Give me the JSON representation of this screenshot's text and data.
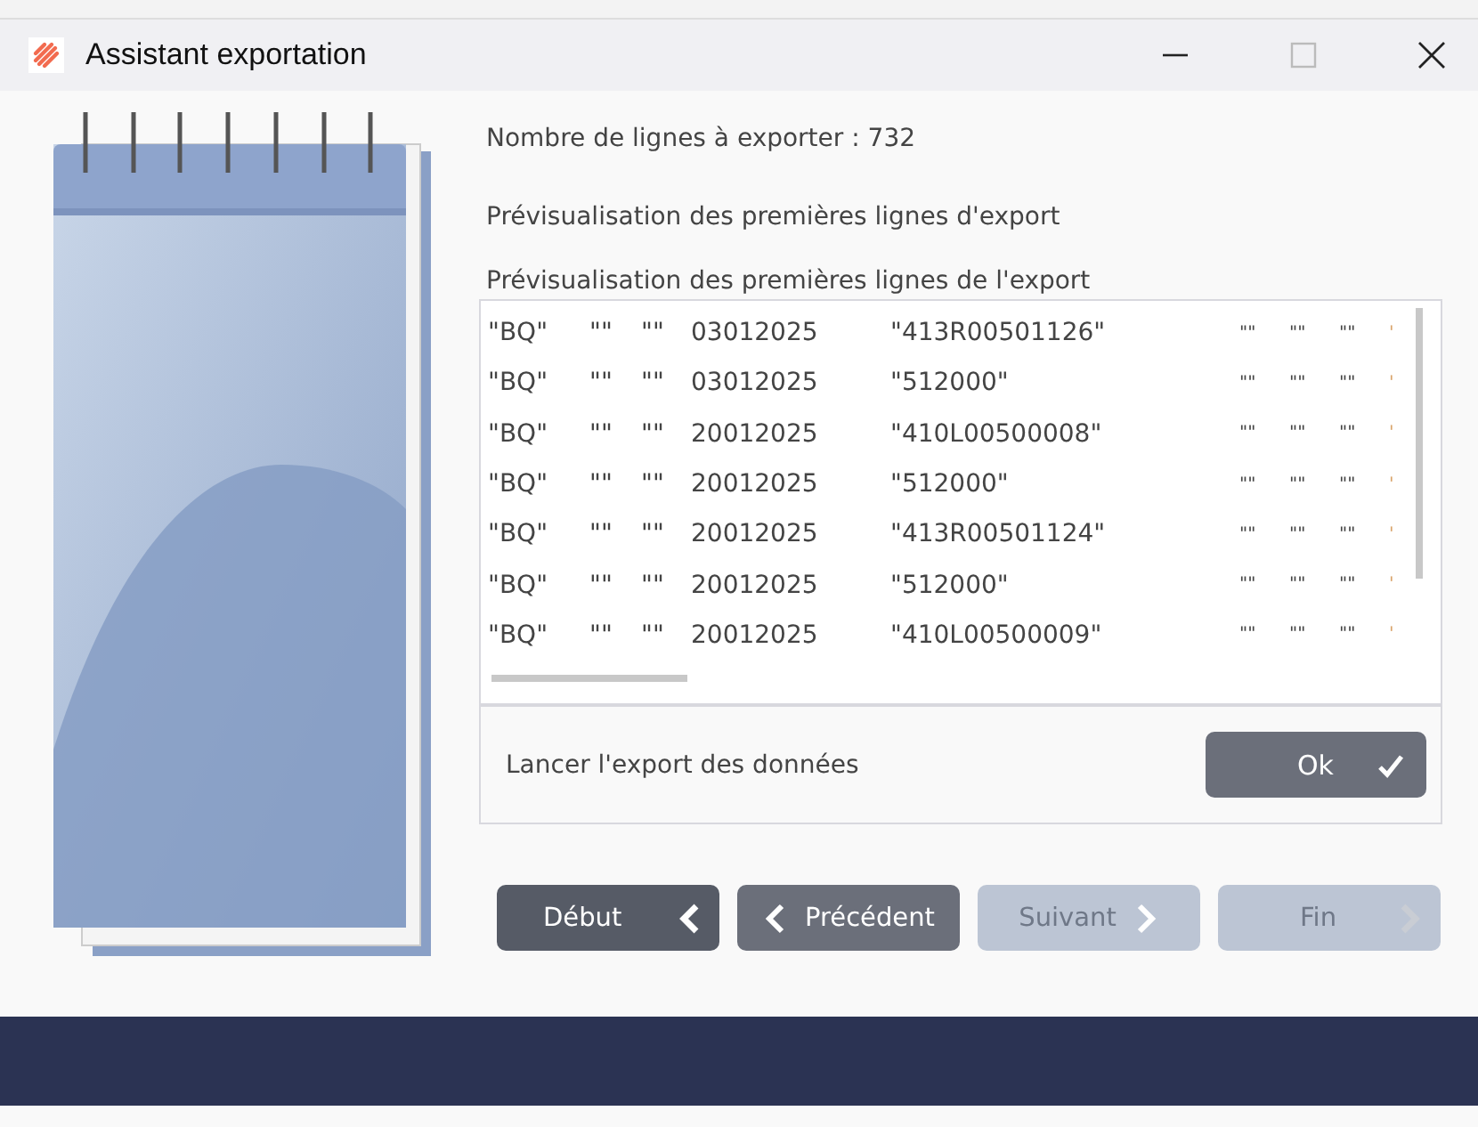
{
  "window": {
    "title": "Assistant exportation"
  },
  "line_count": "Nombre de lignes à exporter : 732",
  "subtitle": "Prévisualisation des premières lignes d'export",
  "preview": {
    "label": "Prévisualisation des premières lignes de l'export",
    "rows": [
      [
        "\"BQ\"",
        "\"\"",
        "\"\"",
        "03012025",
        "\"413R00501126\"",
        "\"\"",
        "\"\"",
        "\"\"",
        "'"
      ],
      [
        "\"BQ\"",
        "\"\"",
        "\"\"",
        "03012025",
        "\"512000\"",
        "\"\"",
        "\"\"",
        "\"\"",
        "'"
      ],
      [
        "\"BQ\"",
        "\"\"",
        "\"\"",
        "20012025",
        "\"410L00500008\"",
        "\"\"",
        "\"\"",
        "\"\"",
        "'"
      ],
      [
        "\"BQ\"",
        "\"\"",
        "\"\"",
        "20012025",
        "\"512000\"",
        "\"\"",
        "\"\"",
        "\"\"",
        "'"
      ],
      [
        "\"BQ\"",
        "\"\"",
        "\"\"",
        "20012025",
        "\"413R00501124\"",
        "\"\"",
        "\"\"",
        "\"\"",
        "'"
      ],
      [
        "\"BQ\"",
        "\"\"",
        "\"\"",
        "20012025",
        "\"512000\"",
        "\"\"",
        "\"\"",
        "\"\"",
        "'"
      ],
      [
        "\"BQ\"",
        "\"\"",
        "\"\"",
        "20012025",
        "\"410L00500009\"",
        "\"\"",
        "\"\"",
        "\"\"",
        "'"
      ]
    ]
  },
  "export": {
    "label": "Lancer l'export des données",
    "button": "Ok"
  },
  "nav_buttons": [
    {
      "label": "Début",
      "kind": "first",
      "disabled": false
    },
    {
      "label": "Précédent",
      "kind": "prev",
      "disabled": false
    },
    {
      "label": "Suivant",
      "kind": "next",
      "disabled": true
    },
    {
      "label": "Fin",
      "kind": "last",
      "disabled": true
    }
  ]
}
